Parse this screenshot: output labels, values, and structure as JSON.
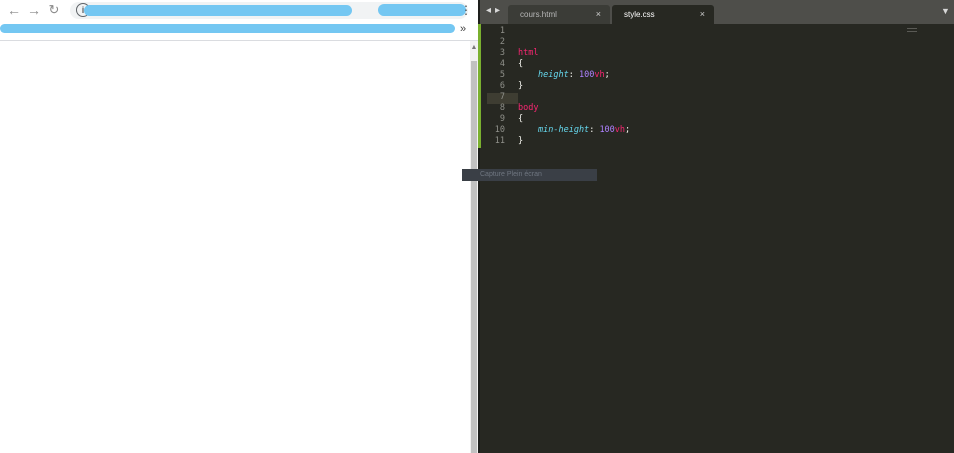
{
  "browser": {
    "nav": {
      "back_icon": "arrow-left-icon",
      "forward_icon": "arrow-right-icon",
      "reload_icon": "reload-icon"
    },
    "omnibox_icon": "info-icon",
    "menu_icon": "vertical-dots-icon",
    "bookmarks_overflow_label": "»"
  },
  "editor": {
    "tabs": [
      {
        "label": "cours.html",
        "close": "×",
        "active": false
      },
      {
        "label": "style.css",
        "close": "×",
        "active": true
      }
    ],
    "tab_nav_prev": "◂",
    "tab_nav_next": "▸",
    "dropdown": "▼",
    "line_numbers": [
      "1",
      "2",
      "3",
      "4",
      "5",
      "6",
      "7",
      "8",
      "9",
      "10",
      "11"
    ],
    "current_line": 5,
    "code": {
      "l3_selector": "html",
      "l4_open": "{",
      "l5_property": "height",
      "l5_colon": ":",
      "l5_value": "100",
      "l5_unit": "vh",
      "l5_semicolon": ";",
      "l6_close": "}",
      "l8_selector": "body",
      "l9_open": "{",
      "l10_property": "min-height",
      "l10_colon": ":",
      "l10_value": "100",
      "l10_unit": "vh",
      "l10_semicolon": ";",
      "l11_close": "}"
    },
    "status_popup": "Capture Plein écran",
    "colors": {
      "background": "#272822",
      "selector": "#f92672",
      "property": "#66d9ef",
      "number": "#ae81ff",
      "gutter_marker": "#7ab02f"
    }
  }
}
